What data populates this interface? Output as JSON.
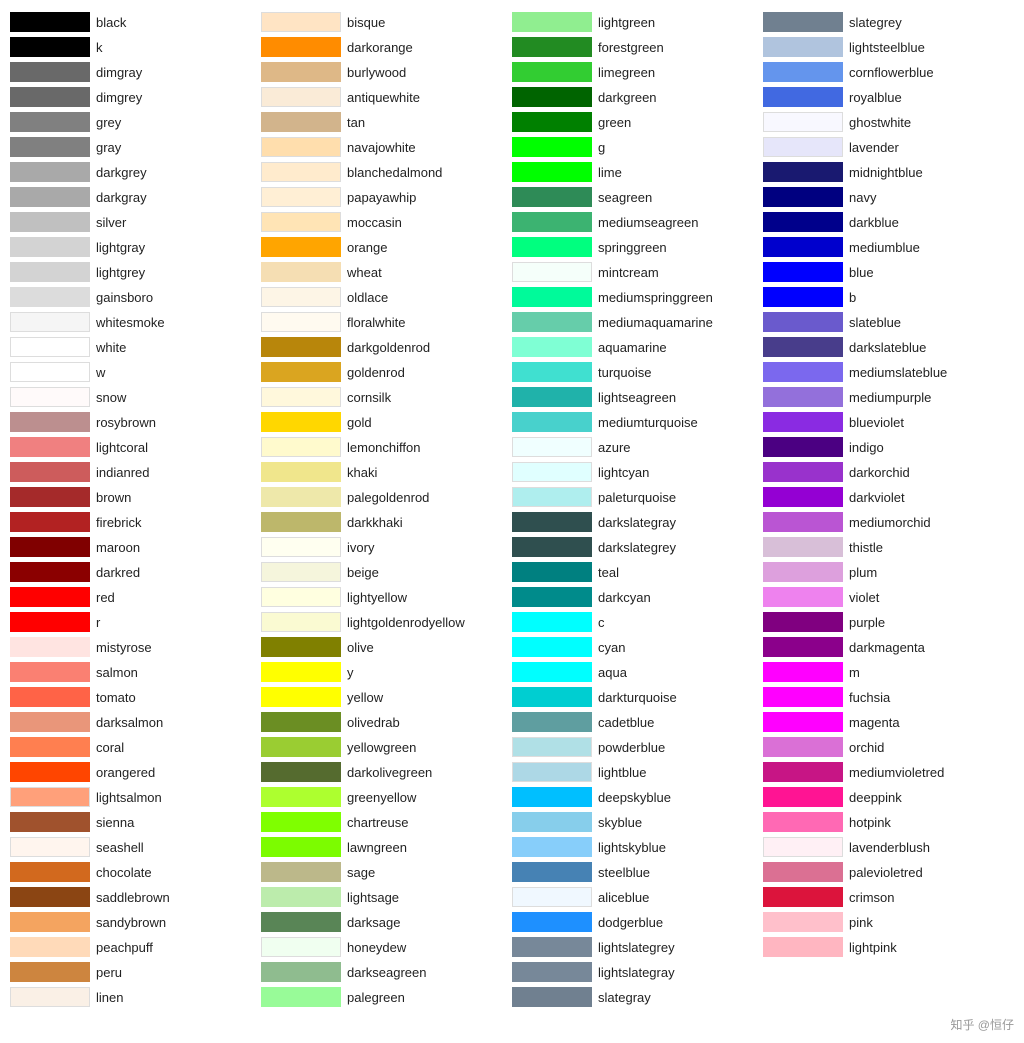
{
  "columns": [
    {
      "id": "col1",
      "items": [
        {
          "name": "black",
          "color": "#000000"
        },
        {
          "name": "k",
          "color": "#000000"
        },
        {
          "name": "dimgray",
          "color": "#696969"
        },
        {
          "name": "dimgrey",
          "color": "#696969"
        },
        {
          "name": "grey",
          "color": "#808080"
        },
        {
          "name": "gray",
          "color": "#808080"
        },
        {
          "name": "darkgrey",
          "color": "#a9a9a9"
        },
        {
          "name": "darkgray",
          "color": "#a9a9a9"
        },
        {
          "name": "silver",
          "color": "#c0c0c0"
        },
        {
          "name": "lightgray",
          "color": "#d3d3d3"
        },
        {
          "name": "lightgrey",
          "color": "#d3d3d3"
        },
        {
          "name": "gainsboro",
          "color": "#dcdcdc"
        },
        {
          "name": "whitesmoke",
          "color": "#f5f5f5"
        },
        {
          "name": "white",
          "color": "#ffffff"
        },
        {
          "name": "w",
          "color": "#ffffff"
        },
        {
          "name": "snow",
          "color": "#fffafa"
        },
        {
          "name": "rosybrown",
          "color": "#bc8f8f"
        },
        {
          "name": "lightcoral",
          "color": "#f08080"
        },
        {
          "name": "indianred",
          "color": "#cd5c5c"
        },
        {
          "name": "brown",
          "color": "#a52a2a"
        },
        {
          "name": "firebrick",
          "color": "#b22222"
        },
        {
          "name": "maroon",
          "color": "#800000"
        },
        {
          "name": "darkred",
          "color": "#8b0000"
        },
        {
          "name": "red",
          "color": "#ff0000"
        },
        {
          "name": "r",
          "color": "#ff0000"
        },
        {
          "name": "mistyrose",
          "color": "#ffe4e1"
        },
        {
          "name": "salmon",
          "color": "#fa8072"
        },
        {
          "name": "tomato",
          "color": "#ff6347"
        },
        {
          "name": "darksalmon",
          "color": "#e9967a"
        },
        {
          "name": "coral",
          "color": "#ff7f50"
        },
        {
          "name": "orangered",
          "color": "#ff4500"
        },
        {
          "name": "lightsalmon",
          "color": "#ffa07a"
        },
        {
          "name": "sienna",
          "color": "#a0522d"
        },
        {
          "name": "seashell",
          "color": "#fff5ee"
        },
        {
          "name": "chocolate",
          "color": "#d2691e"
        },
        {
          "name": "saddlebrown",
          "color": "#8b4513"
        },
        {
          "name": "sandybrown",
          "color": "#f4a460"
        },
        {
          "name": "peachpuff",
          "color": "#ffdab9"
        },
        {
          "name": "peru",
          "color": "#cd853f"
        },
        {
          "name": "linen",
          "color": "#faf0e6"
        }
      ]
    },
    {
      "id": "col2",
      "items": [
        {
          "name": "bisque",
          "color": "#ffe4c4"
        },
        {
          "name": "darkorange",
          "color": "#ff8c00"
        },
        {
          "name": "burlywood",
          "color": "#deb887"
        },
        {
          "name": "antiquewhite",
          "color": "#faebd7"
        },
        {
          "name": "tan",
          "color": "#d2b48c"
        },
        {
          "name": "navajowhite",
          "color": "#ffdead"
        },
        {
          "name": "blanchedalmond",
          "color": "#ffebcd"
        },
        {
          "name": "papayawhip",
          "color": "#ffefd5"
        },
        {
          "name": "moccasin",
          "color": "#ffe4b5"
        },
        {
          "name": "orange",
          "color": "#ffa500"
        },
        {
          "name": "wheat",
          "color": "#f5deb3"
        },
        {
          "name": "oldlace",
          "color": "#fdf5e6"
        },
        {
          "name": "floralwhite",
          "color": "#fffaf0"
        },
        {
          "name": "darkgoldenrod",
          "color": "#b8860b"
        },
        {
          "name": "goldenrod",
          "color": "#daa520"
        },
        {
          "name": "cornsilk",
          "color": "#fff8dc"
        },
        {
          "name": "gold",
          "color": "#ffd700"
        },
        {
          "name": "lemonchiffon",
          "color": "#fffacd"
        },
        {
          "name": "khaki",
          "color": "#f0e68c"
        },
        {
          "name": "palegoldenrod",
          "color": "#eee8aa"
        },
        {
          "name": "darkkhaki",
          "color": "#bdb76b"
        },
        {
          "name": "ivory",
          "color": "#fffff0"
        },
        {
          "name": "beige",
          "color": "#f5f5dc"
        },
        {
          "name": "lightyellow",
          "color": "#ffffe0"
        },
        {
          "name": "lightgoldenrodyellow",
          "color": "#fafad2"
        },
        {
          "name": "olive",
          "color": "#808000"
        },
        {
          "name": "y",
          "color": "#ffff00"
        },
        {
          "name": "yellow",
          "color": "#ffff00"
        },
        {
          "name": "olivedrab",
          "color": "#6b8e23"
        },
        {
          "name": "yellowgreen",
          "color": "#9acd32"
        },
        {
          "name": "darkolivegreen",
          "color": "#556b2f"
        },
        {
          "name": "greenyellow",
          "color": "#adff2f"
        },
        {
          "name": "chartreuse",
          "color": "#7fff00"
        },
        {
          "name": "lawngreen",
          "color": "#7cfc00"
        },
        {
          "name": "sage",
          "color": "#bcb88a"
        },
        {
          "name": "lightsage",
          "color": "#bcecac"
        },
        {
          "name": "darksage",
          "color": "#598556"
        },
        {
          "name": "honeydew",
          "color": "#f0fff0"
        },
        {
          "name": "darkseagreen",
          "color": "#8fbc8f"
        },
        {
          "name": "palegreen",
          "color": "#98fb98"
        }
      ]
    },
    {
      "id": "col3",
      "items": [
        {
          "name": "lightgreen",
          "color": "#90ee90"
        },
        {
          "name": "forestgreen",
          "color": "#228b22"
        },
        {
          "name": "limegreen",
          "color": "#32cd32"
        },
        {
          "name": "darkgreen",
          "color": "#006400"
        },
        {
          "name": "green",
          "color": "#008000"
        },
        {
          "name": "g",
          "color": "#00ff00"
        },
        {
          "name": "lime",
          "color": "#00ff00"
        },
        {
          "name": "seagreen",
          "color": "#2e8b57"
        },
        {
          "name": "mediumseagreen",
          "color": "#3cb371"
        },
        {
          "name": "springgreen",
          "color": "#00ff7f"
        },
        {
          "name": "mintcream",
          "color": "#f5fffa"
        },
        {
          "name": "mediumspringgreen",
          "color": "#00fa9a"
        },
        {
          "name": "mediumaquamarine",
          "color": "#66cdaa"
        },
        {
          "name": "aquamarine",
          "color": "#7fffd4"
        },
        {
          "name": "turquoise",
          "color": "#40e0d0"
        },
        {
          "name": "lightseagreen",
          "color": "#20b2aa"
        },
        {
          "name": "mediumturquoise",
          "color": "#48d1cc"
        },
        {
          "name": "azure",
          "color": "#f0ffff"
        },
        {
          "name": "lightcyan",
          "color": "#e0ffff"
        },
        {
          "name": "paleturquoise",
          "color": "#afeeee"
        },
        {
          "name": "darkslategray",
          "color": "#2f4f4f"
        },
        {
          "name": "darkslategrey",
          "color": "#2f4f4f"
        },
        {
          "name": "teal",
          "color": "#008080"
        },
        {
          "name": "darkcyan",
          "color": "#008b8b"
        },
        {
          "name": "c",
          "color": "#00ffff"
        },
        {
          "name": "cyan",
          "color": "#00ffff"
        },
        {
          "name": "aqua",
          "color": "#00ffff"
        },
        {
          "name": "darkturquoise",
          "color": "#00ced1"
        },
        {
          "name": "cadetblue",
          "color": "#5f9ea0"
        },
        {
          "name": "powderblue",
          "color": "#b0e0e6"
        },
        {
          "name": "lightblue",
          "color": "#add8e6"
        },
        {
          "name": "deepskyblue",
          "color": "#00bfff"
        },
        {
          "name": "skyblue",
          "color": "#87ceeb"
        },
        {
          "name": "lightskyblue",
          "color": "#87cefa"
        },
        {
          "name": "steelblue",
          "color": "#4682b4"
        },
        {
          "name": "aliceblue",
          "color": "#f0f8ff"
        },
        {
          "name": "dodgerblue",
          "color": "#1e90ff"
        },
        {
          "name": "lightslategrey",
          "color": "#778899"
        },
        {
          "name": "lightslategray",
          "color": "#778899"
        },
        {
          "name": "slategray",
          "color": "#708090"
        }
      ]
    },
    {
      "id": "col4",
      "items": [
        {
          "name": "slategrey",
          "color": "#708090"
        },
        {
          "name": "lightsteelblue",
          "color": "#b0c4de"
        },
        {
          "name": "cornflowerblue",
          "color": "#6495ed"
        },
        {
          "name": "royalblue",
          "color": "#4169e1"
        },
        {
          "name": "ghostwhite",
          "color": "#f8f8ff"
        },
        {
          "name": "lavender",
          "color": "#e6e6fa"
        },
        {
          "name": "midnightblue",
          "color": "#191970"
        },
        {
          "name": "navy",
          "color": "#000080"
        },
        {
          "name": "darkblue",
          "color": "#00008b"
        },
        {
          "name": "mediumblue",
          "color": "#0000cd"
        },
        {
          "name": "blue",
          "color": "#0000ff"
        },
        {
          "name": "b",
          "color": "#0000ff"
        },
        {
          "name": "slateblue",
          "color": "#6a5acd"
        },
        {
          "name": "darkslateblue",
          "color": "#483d8b"
        },
        {
          "name": "mediumslateblue",
          "color": "#7b68ee"
        },
        {
          "name": "mediumpurple",
          "color": "#9370db"
        },
        {
          "name": "blueviolet",
          "color": "#8a2be2"
        },
        {
          "name": "indigo",
          "color": "#4b0082"
        },
        {
          "name": "darkorchid",
          "color": "#9932cc"
        },
        {
          "name": "darkviolet",
          "color": "#9400d3"
        },
        {
          "name": "mediumorchid",
          "color": "#ba55d3"
        },
        {
          "name": "thistle",
          "color": "#d8bfd8"
        },
        {
          "name": "plum",
          "color": "#dda0dd"
        },
        {
          "name": "violet",
          "color": "#ee82ee"
        },
        {
          "name": "purple",
          "color": "#800080"
        },
        {
          "name": "darkmagenta",
          "color": "#8b008b"
        },
        {
          "name": "m",
          "color": "#ff00ff"
        },
        {
          "name": "fuchsia",
          "color": "#ff00ff"
        },
        {
          "name": "magenta",
          "color": "#ff00ff"
        },
        {
          "name": "orchid",
          "color": "#da70d6"
        },
        {
          "name": "mediumvioletred",
          "color": "#c71585"
        },
        {
          "name": "deeppink",
          "color": "#ff1493"
        },
        {
          "name": "hotpink",
          "color": "#ff69b4"
        },
        {
          "name": "lavenderblush",
          "color": "#fff0f5"
        },
        {
          "name": "palevioletred",
          "color": "#db7093"
        },
        {
          "name": "crimson",
          "color": "#dc143c"
        },
        {
          "name": "pink",
          "color": "#ffc0cb"
        },
        {
          "name": "lightpink",
          "color": "#ffb6c1"
        }
      ]
    }
  ],
  "watermark": "知乎 @恒仔"
}
